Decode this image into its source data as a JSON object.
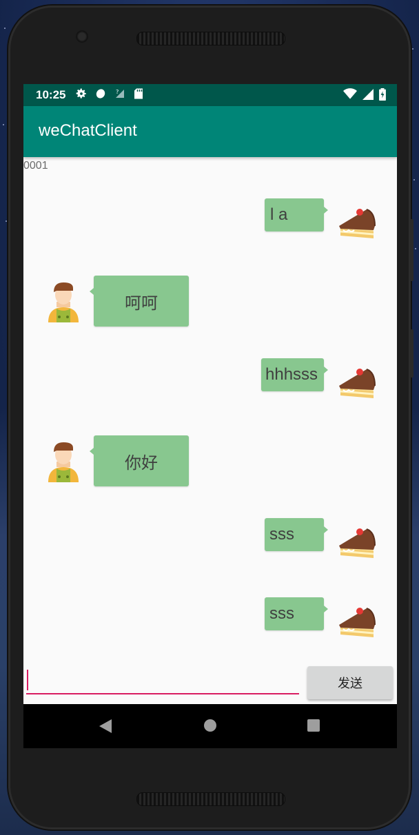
{
  "status_bar": {
    "time": "10:25",
    "left_icons": [
      "settings-icon",
      "data-icon",
      "signal-question-icon",
      "sd-card-icon"
    ],
    "right_icons": [
      "wifi-icon",
      "cell-signal-icon",
      "battery-icon"
    ]
  },
  "app_bar": {
    "title": "weChatClient"
  },
  "user_id": "0001",
  "messages": [
    {
      "side": "right",
      "text": "l a",
      "avatar": "cake-avatar-icon"
    },
    {
      "side": "left",
      "text": "呵呵",
      "avatar": "boy-avatar-icon"
    },
    {
      "side": "right",
      "text": "hhhsss",
      "avatar": "cake-avatar-icon"
    },
    {
      "side": "left",
      "text": "你好",
      "avatar": "boy-avatar-icon"
    },
    {
      "side": "right",
      "text": "sss",
      "avatar": "cake-avatar-icon"
    },
    {
      "side": "right",
      "text": "sss",
      "avatar": "cake-avatar-icon"
    }
  ],
  "input": {
    "value": "",
    "placeholder": ""
  },
  "send_button": {
    "label": "发送"
  },
  "colors": {
    "status_bar": "#00574b",
    "app_bar": "#008577",
    "bubble": "#88c78f",
    "accent": "#d81b60"
  },
  "nav_bar": {
    "icons": [
      "back-icon",
      "home-icon",
      "recent-apps-icon"
    ]
  }
}
